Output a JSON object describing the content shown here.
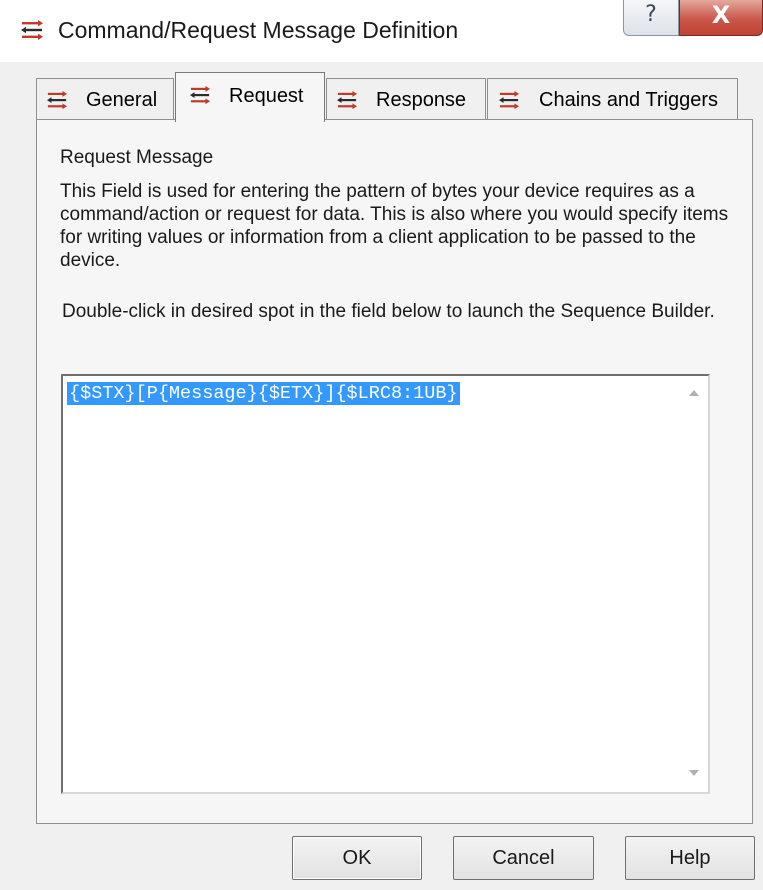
{
  "window": {
    "title": "Command/Request Message Definition",
    "help_glyph": "?",
    "close_glyph": "X",
    "icon": "command-request-icon"
  },
  "tabs": [
    {
      "label": "General",
      "icon": "command-request-icon",
      "selected": false
    },
    {
      "label": "Request",
      "icon": "command-request-icon",
      "selected": true
    },
    {
      "label": "Response",
      "icon": "command-request-icon",
      "selected": false
    },
    {
      "label": "Chains and Triggers",
      "icon": "command-request-icon",
      "selected": false
    }
  ],
  "request_tab": {
    "section_title": "Request Message",
    "description": "This Field is used for entering the pattern of bytes your device requires as a command/action or request for data.  This is also where you would specify items for writing values or information from a client application to be passed to the device.",
    "hint": "Double-click in desired spot in the field below to launch the Sequence Builder.",
    "message_value": "{$STX}[P{Message}{$ETX}]{$LRC8:1UB}"
  },
  "buttons": {
    "ok": "OK",
    "cancel": "Cancel",
    "help": "Help"
  },
  "colors": {
    "icon_red": "#c0392b",
    "icon_dark": "#2b2b2b",
    "selection": "#3399ff",
    "close_button": "#c9584a"
  }
}
